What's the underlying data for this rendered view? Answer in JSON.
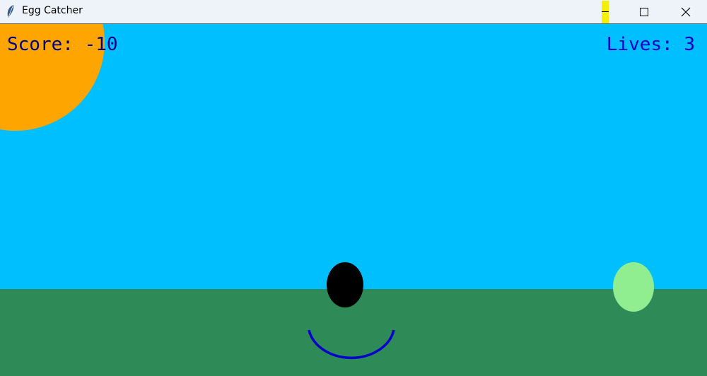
{
  "window": {
    "title": "Egg Catcher",
    "icon": "feather-icon",
    "controls": [
      "minimize-icon",
      "maximize-icon",
      "close-icon"
    ],
    "minimize_highlight_color": "#f3ef00"
  },
  "game": {
    "score_text": "Score: -10",
    "lives_text": "Lives: 3",
    "colors": {
      "sky": "#00bfff",
      "grass": "#2e8b57",
      "sun": "#ffa500",
      "catcher": "#0000cd",
      "egg_black": "#000000",
      "egg_green": "#90ee90",
      "score_text": "#000080",
      "lives_text": "#0000cd"
    }
  }
}
